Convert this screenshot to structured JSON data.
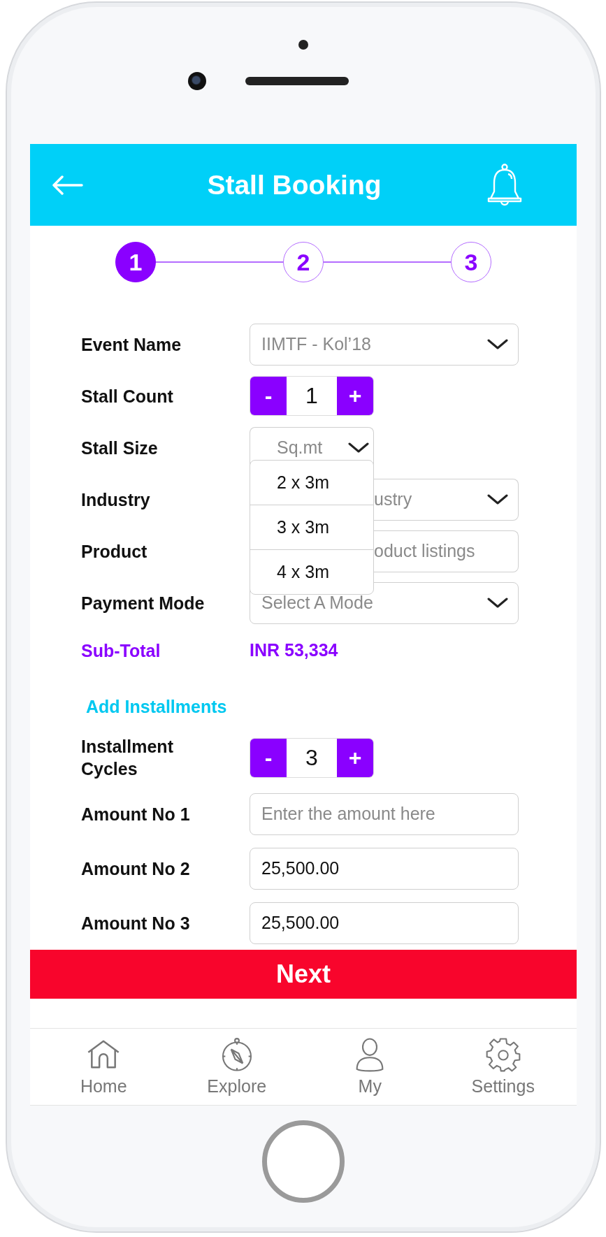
{
  "header": {
    "title": "Stall Booking"
  },
  "steps": [
    {
      "label": "1",
      "selected": true
    },
    {
      "label": "2",
      "selected": false
    },
    {
      "label": "3",
      "selected": false
    }
  ],
  "fields": [
    {
      "kind": "select",
      "label": "Event Name",
      "placeholder": "IIMTF - Kol’18"
    },
    {
      "kind": "stepper",
      "label": "Stall Count",
      "minus": "-",
      "value": "1",
      "plus": "+"
    },
    {
      "kind": "select",
      "label": "Stall Size",
      "placeholder": "Sq.mt",
      "expanded": true,
      "options": [
        "2 x 3m",
        "3 x 3m",
        "4 x 3m"
      ]
    },
    {
      "kind": "select",
      "label": "Industry",
      "placeholder": "ustry"
    },
    {
      "kind": "input",
      "label": "Product",
      "placeholder": "oduct listings"
    },
    {
      "kind": "select",
      "label": "Payment Mode",
      "placeholder": "Select A Mode"
    },
    {
      "kind": "total",
      "label": "Sub-Total",
      "value": "INR 53,334"
    }
  ],
  "add_installments": "Add Installments",
  "installment_fields": [
    {
      "kind": "stepper",
      "label": "Installment Cycles",
      "minus": "-",
      "value": "3",
      "plus": "+"
    },
    {
      "kind": "input",
      "label": "Amount No 1",
      "placeholder": "Enter the amount here"
    },
    {
      "kind": "input",
      "label": "Amount No 2",
      "value": "25,500.00"
    },
    {
      "kind": "input",
      "label": "Amount No 3",
      "value": "25,500.00"
    }
  ],
  "next_button": "Next",
  "nav": [
    {
      "label": "Home"
    },
    {
      "label": "Explore"
    },
    {
      "label": "My"
    },
    {
      "label": "Settings"
    }
  ]
}
